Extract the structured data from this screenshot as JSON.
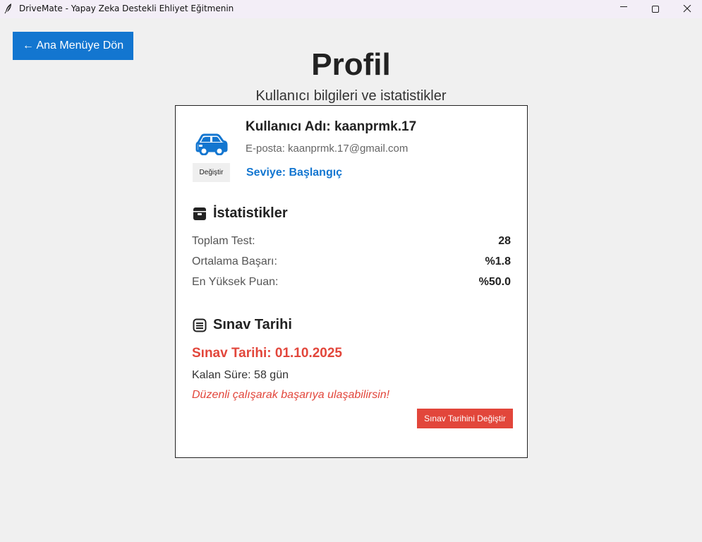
{
  "window": {
    "title": "DriveMate - Yapay Zeka Destekli Ehliyet Eğitmenin",
    "app_icon": "feather-icon",
    "controls": [
      "minimize-icon",
      "maximize-icon",
      "close-icon"
    ]
  },
  "nav": {
    "back_label": "← Ana Menüye Dön"
  },
  "header": {
    "title": "Profil",
    "subtitle": "Kullanıcı bilgileri ve istatistikler"
  },
  "profile": {
    "avatar_icon": "car-icon",
    "change_avatar_label": "Değiştir",
    "username": "Kullanıcı Adı: kaanprmk.17",
    "email": "E-posta: kaanprmk.17@gmail.com",
    "level": "Seviye: Başlangıç"
  },
  "stats": {
    "icon": "box-icon",
    "title": "İstatistikler",
    "rows": [
      {
        "label": "Toplam Test:",
        "value": "28"
      },
      {
        "label": "Ortalama Başarı:",
        "value": "%1.8"
      },
      {
        "label": "En Yüksek Puan:",
        "value": "%50.0"
      }
    ]
  },
  "exam": {
    "icon": "calendar-icon",
    "title": "Sınav Tarihi",
    "date": "Sınav Tarihi: 01.10.2025",
    "remaining": "Kalan Süre: 58 gün",
    "motivation": "Düzenli çalışarak başarıya ulaşabilirsin!",
    "change_label": "Sınav Tarihini Değiştir"
  },
  "colors": {
    "primary": "#1376d0",
    "danger": "#e2463b",
    "background": "#f0f0f0",
    "titlebar": "#f3eef7"
  }
}
